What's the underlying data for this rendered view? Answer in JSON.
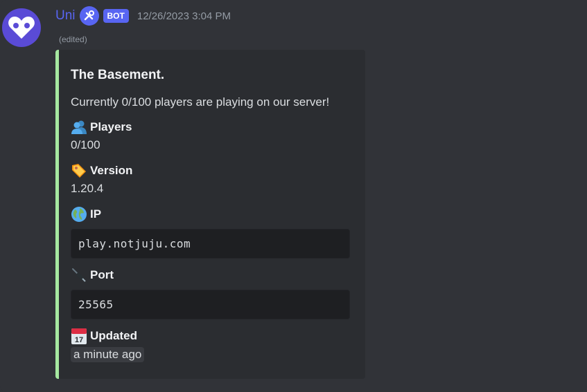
{
  "message": {
    "username": "Uni",
    "bot_tag": "BOT",
    "timestamp": "12/26/2023 3:04 PM",
    "edited": "(edited)",
    "accent_color": "#a6e8a0",
    "username_color": "#5865f2"
  },
  "embed": {
    "title": "The Basement.",
    "description": "Currently 0/100 players are playing on our server!",
    "fields": [
      {
        "icon": "players-icon",
        "name": "Players",
        "value": "0/100"
      },
      {
        "icon": "tag-icon",
        "name": "Version",
        "value": "1.20.4"
      },
      {
        "icon": "globe-icon",
        "name": "IP",
        "value": "play.notjuju.com"
      },
      {
        "icon": "plug-icon",
        "name": "Port",
        "value": "25565"
      },
      {
        "icon": "calendar-icon",
        "name": "Updated",
        "value": "a minute ago"
      }
    ]
  }
}
